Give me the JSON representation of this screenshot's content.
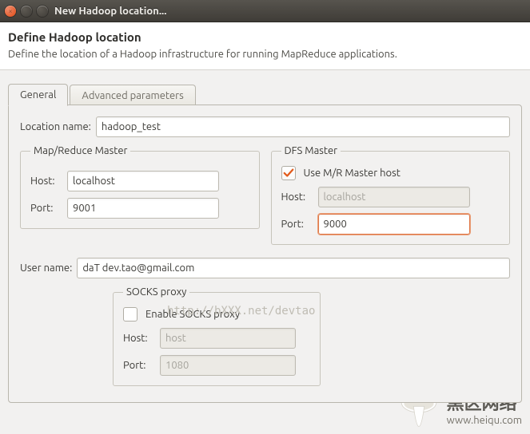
{
  "window": {
    "title": "New Hadoop location..."
  },
  "header": {
    "title": "Define Hadoop location",
    "subtitle": "Define the location of a Hadoop infrastructure for running MapReduce applications."
  },
  "tabs": {
    "general": "General",
    "advanced": "Advanced parameters"
  },
  "general": {
    "location_name_label": "Location name:",
    "location_name_value": "hadoop_test",
    "mr_master": {
      "legend": "Map/Reduce Master",
      "host_label": "Host:",
      "host_value": "localhost",
      "port_label": "Port:",
      "port_value": "9001"
    },
    "dfs_master": {
      "legend": "DFS Master",
      "use_mr_label": "Use M/R Master host",
      "use_mr_checked": true,
      "host_label": "Host:",
      "host_value": "localhost",
      "port_label": "Port:",
      "port_value": "9000"
    },
    "user_name_label": "User name:",
    "user_name_value": "daT dev.tao@gmail.com",
    "socks": {
      "legend": "SOCKS proxy",
      "enable_label": "Enable SOCKS proxy",
      "enable_checked": false,
      "host_label": "Host:",
      "host_value": "host",
      "port_label": "Port:",
      "port_value": "1080"
    }
  },
  "watermarks": {
    "url_faint": "http://bXXX.net/devtao",
    "site_cn": "黑区网络",
    "site_url": "www.heiqu.com"
  }
}
